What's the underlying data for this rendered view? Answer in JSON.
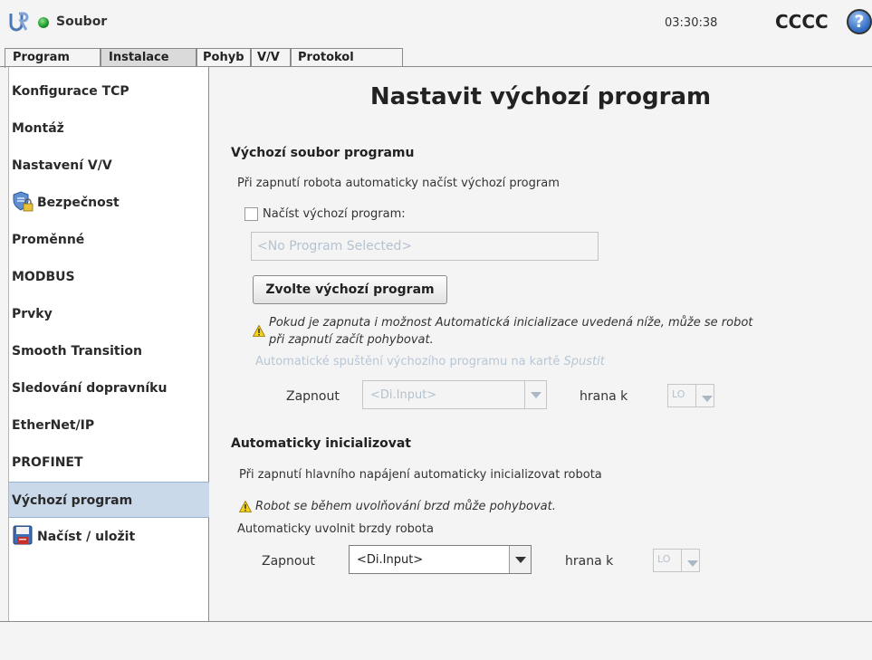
{
  "header": {
    "file_label": "Soubor",
    "clock": "03:30:38",
    "robot_name": "CCCC",
    "help_symbol": "?",
    "status_color": "#1e9c2c"
  },
  "tabs": [
    {
      "label": "Program"
    },
    {
      "label": "Instalace"
    },
    {
      "label": "Pohyb"
    },
    {
      "label": "V/V"
    },
    {
      "label": "Protokol"
    }
  ],
  "sidebar": {
    "items": [
      {
        "label": "Konfigurace TCP"
      },
      {
        "label": "Montáž"
      },
      {
        "label": "Nastavení V/V"
      },
      {
        "label": "Bezpečnost",
        "icon": "shield-lock-icon"
      },
      {
        "label": "Proměnné"
      },
      {
        "label": "MODBUS"
      },
      {
        "label": "Prvky"
      },
      {
        "label": "Smooth Transition"
      },
      {
        "label": "Sledování dopravníku"
      },
      {
        "label": "EtherNet/IP"
      },
      {
        "label": "PROFINET"
      },
      {
        "label": "Výchozí program"
      },
      {
        "label": "Načíst / uložit",
        "icon": "floppy-disk-icon"
      }
    ],
    "selected": "Výchozí program"
  },
  "main": {
    "title": "Nastavit výchozí program",
    "default_file": {
      "heading": "Výchozí soubor programu",
      "description": "Při zapnutí robota automaticky načíst výchozí program",
      "checkbox_label": "Načíst výchozí program:",
      "program_field": "<No Program Selected>",
      "choose_button": "Zvolte výchozí program",
      "warning_line1": "Pokud je zapnuta i možnost Automatická inicializace uvedená níže, může se robot",
      "warning_line2": "při zapnutí začít pohybovat.",
      "autostart_text": "Automatické spuštění výchozího programu na kartě",
      "autostart_tab": "Spustit",
      "enable_label": "Zapnout",
      "input_value": "<Di.Input>",
      "edge_label": "hrana k",
      "edge_value": "LO"
    },
    "auto_init": {
      "heading": "Automaticky inicializovat",
      "description": "Při zapnutí hlavního napájení automaticky inicializovat robota",
      "warning": "Robot se během uvolňování brzd může pohybovat.",
      "release_label": "Automaticky uvolnit brzdy robota",
      "enable_label": "Zapnout",
      "input_value": "<Di.Input>",
      "edge_label": "hrana k",
      "edge_value": "LO"
    }
  }
}
